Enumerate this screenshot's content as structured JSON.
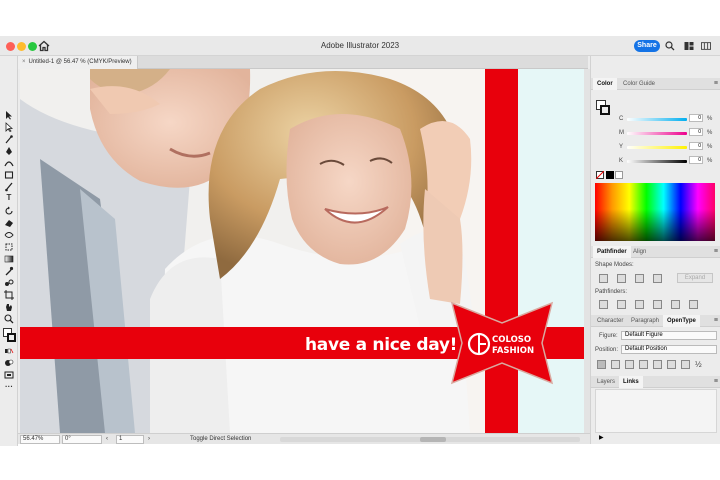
{
  "window": {
    "title": "Adobe Illustrator 2023",
    "share_label": "Share"
  },
  "document": {
    "tab_label": "Untitled-1 @ 56.47 % (CMYK/Preview)",
    "close_glyph": "×"
  },
  "artwork": {
    "slogan": "have a nice day!",
    "logo_line1": "COLOSO",
    "logo_line2": "FASHION",
    "ribbon_color": "#e8000c"
  },
  "statusbar": {
    "zoom": "56.47%",
    "rotation": "0°",
    "artboard": "1",
    "tool_hint": "Toggle Direct Selection"
  },
  "color_panel": {
    "tabs": [
      "Color",
      "Color Guide"
    ],
    "channels": [
      {
        "label": "C",
        "value": "0",
        "unit": "%",
        "color": "#00aeef"
      },
      {
        "label": "M",
        "value": "0",
        "unit": "%",
        "color": "#ec008c"
      },
      {
        "label": "Y",
        "value": "0",
        "unit": "%",
        "color": "#fff200"
      },
      {
        "label": "K",
        "value": "0",
        "unit": "%",
        "color": "#000000"
      }
    ]
  },
  "pathfinder_panel": {
    "tabs": [
      "Pathfinder",
      "Align"
    ],
    "shape_modes_label": "Shape Modes:",
    "expand_label": "Expand",
    "pathfinders_label": "Pathfinders:"
  },
  "type_panel": {
    "tabs": [
      "Character",
      "Paragraph",
      "OpenType"
    ],
    "figure_label": "Figure:",
    "figure_value": "Default Figure",
    "position_label": "Position:",
    "position_value": "Default Position",
    "fraction_glyph": "½"
  },
  "layers_panel": {
    "tabs": [
      "Layers",
      "Links"
    ]
  },
  "icons": {
    "home": "home-icon",
    "search": "search-icon",
    "arrange": "arrange-documents-icon",
    "panels": "workspace-icon"
  }
}
